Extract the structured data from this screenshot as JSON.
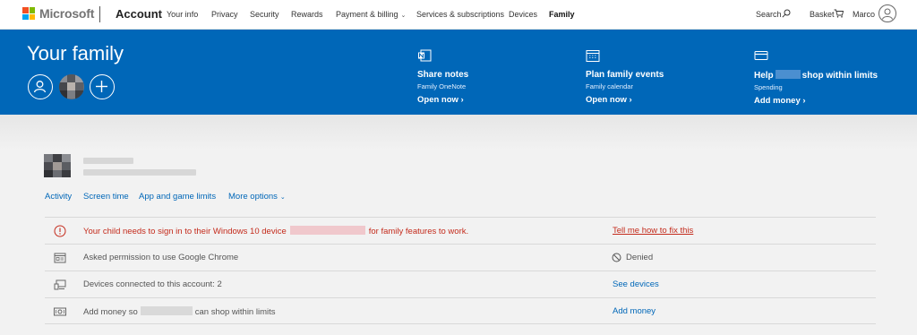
{
  "topnav": {
    "brand": "Microsoft",
    "section": "Account",
    "links": [
      {
        "label": "Your info"
      },
      {
        "label": "Privacy"
      },
      {
        "label": "Security"
      },
      {
        "label": "Rewards"
      },
      {
        "label": "Payment & billing"
      },
      {
        "label": "Services & subscriptions"
      },
      {
        "label": "Devices"
      },
      {
        "label": "Family"
      }
    ],
    "search_label": "Search",
    "basket_label": "Basket",
    "user_name": "Marco"
  },
  "banner": {
    "title": "Your family",
    "features": [
      {
        "title": "Share notes",
        "subtitle": "Family OneNote",
        "link": "Open now ›",
        "icon": "onenote-icon"
      },
      {
        "title": "Plan family events",
        "subtitle": "Family calendar",
        "link": "Open now ›",
        "icon": "calendar-icon"
      },
      {
        "title_prefix": "Help",
        "title_suffix": "shop within limits",
        "subtitle": "Spending",
        "link": "Add money ›",
        "icon": "card-icon"
      }
    ]
  },
  "child": {
    "tabs": [
      "Activity",
      "Screen time",
      "App and game limits",
      "More options"
    ]
  },
  "rows": [
    {
      "icon": "warning-icon",
      "text_prefix": "Your child needs to sign in to their Windows 10 device",
      "text_suffix": "for family features to work.",
      "action": "Tell me how to fix this"
    },
    {
      "icon": "browser-icon",
      "text": "Asked permission to use Google Chrome",
      "status": "Denied",
      "status_icon": "denied-icon"
    },
    {
      "icon": "devices-icon",
      "text": "Devices connected to this account: 2",
      "action": "See devices"
    },
    {
      "icon": "money-icon",
      "text_prefix": "Add money so",
      "text_suffix": "can shop within limits",
      "action": "Add money"
    }
  ],
  "colors": {
    "banner": "#0067b8",
    "link": "#0067b8",
    "warning": "#c42b1c"
  }
}
